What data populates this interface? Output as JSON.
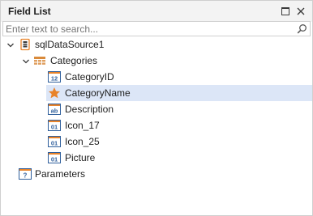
{
  "window": {
    "title": "Field List",
    "maximize_icon": "maximize-icon",
    "close_icon": "close-icon"
  },
  "search": {
    "placeholder": "Enter text to search...",
    "value": "",
    "icon": "search-icon"
  },
  "tree": {
    "datasource": {
      "label": "sqlDataSource1",
      "icon": "database-icon",
      "expanded": true
    },
    "table": {
      "label": "Categories",
      "icon": "table-icon",
      "expanded": true
    },
    "fields": [
      {
        "label": "CategoryID",
        "icon": "numeric-field-icon",
        "badge": "12"
      },
      {
        "label": "CategoryName",
        "icon": "star-icon",
        "badge": "",
        "selected": true
      },
      {
        "label": "Description",
        "icon": "text-field-icon",
        "badge": "ab"
      },
      {
        "label": "Icon_17",
        "icon": "binary-field-icon",
        "badge": "01"
      },
      {
        "label": "Icon_25",
        "icon": "binary-field-icon",
        "badge": "01"
      },
      {
        "label": "Picture",
        "icon": "binary-field-icon",
        "badge": "01"
      }
    ],
    "parameters": {
      "label": "Parameters",
      "icon": "parameters-icon",
      "badge": "?"
    }
  },
  "colors": {
    "accent_orange": "#e8832a",
    "selection": "#dce6f7",
    "field_icon_blue": "#2f5f9c",
    "table_grid": "#d98a3a"
  }
}
